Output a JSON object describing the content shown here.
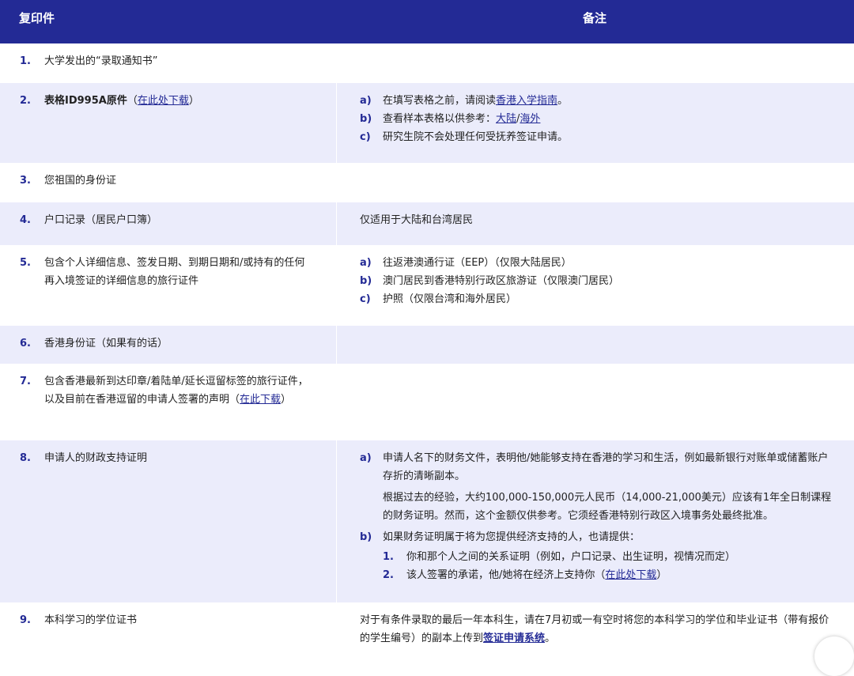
{
  "header": {
    "col1": "复印件",
    "col2": "备注"
  },
  "rows": [
    {
      "num": "1.",
      "left": "大学发出的“录取通知书”"
    },
    {
      "num": "2.",
      "left_bold": "表格ID995A原件",
      "left_pre": "（",
      "left_link": "在此处下载",
      "left_post": "）",
      "notes": [
        {
          "mark": "a)",
          "pre": "在填写表格之前，请阅读",
          "link": "香港入学指南",
          "post": "。"
        },
        {
          "mark": "b)",
          "pre": "查看样本表格以供参考：",
          "link1": "大陆",
          "sep": "/",
          "link2": "海外"
        },
        {
          "mark": "c)",
          "text": "研究生院不会处理任何受抚养签证申请。"
        }
      ]
    },
    {
      "num": "3.",
      "left": "您祖国的身份证"
    },
    {
      "num": "4.",
      "left": "户口记录（居民户口簿）",
      "note": "仅适用于大陆和台湾居民"
    },
    {
      "num": "5.",
      "left": "包含个人详细信息、签发日期、到期日期和/或持有的任何再入境签证的详细信息的旅行证件",
      "notes": [
        {
          "mark": "a)",
          "text": "往返港澳通行证（EEP）（仅限大陆居民）"
        },
        {
          "mark": "b)",
          "text": "澳门居民到香港特别行政区旅游证（仅限澳门居民）"
        },
        {
          "mark": "c)",
          "text": "护照（仅限台湾和海外居民）"
        }
      ]
    },
    {
      "num": "6.",
      "left": "香港身份证（如果有的话）"
    },
    {
      "num": "7.",
      "left": "包含香港最新到达印章/着陆单/延长逗留标签的旅行证件，以及目前在香港逗留的申请人签署的声明（",
      "left_link": "在此下载",
      "left_post": "）"
    },
    {
      "num": "8.",
      "left": "申请人的财政支持证明",
      "note_a_mark": "a)",
      "note_a": "申请人名下的财务文件，表明他/她能够支持在香港的学习和生活，例如最新银行对账单或储蓄账户存折的清晰副本。",
      "note_a_para": "根据过去的经验，大约100,000-150,000元人民币（14,000-21,000美元）应该有1年全日制课程的财务证明。然而，这个金额仅供参考。它须经香港特别行政区入境事务处最终批准。",
      "note_b_mark": "b)",
      "note_b": "如果财务证明属于将为您提供经济支持的人，也请提供：",
      "note_b_subs": [
        {
          "mark": "1.",
          "text": "你和那个人之间的关系证明（例如，户口记录、出生证明，视情况而定）"
        },
        {
          "mark": "2.",
          "pre": "该人签署的承诺，他/她将在经济上支持你（",
          "link": "在此处下载",
          "post": "）"
        }
      ]
    },
    {
      "num": "9.",
      "left": "本科学习的学位证书",
      "note_pre": "对于有条件录取的最后一年本科生，请在7月初或一有空时将您的本科学习的学位和毕业证书（带有报价的学生编号）的副本上传到",
      "note_link": "签证申请系统",
      "note_post": "。"
    }
  ]
}
